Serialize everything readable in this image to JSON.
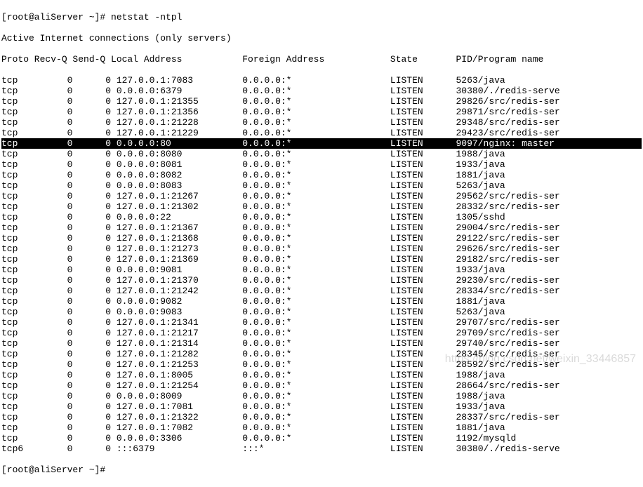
{
  "terminal": {
    "line0": "[root@aliServer ~]# netstat -ntpl",
    "line1": "Active Internet connections (only servers)",
    "header": {
      "proto": "Proto",
      "recvq": "Recv-Q",
      "sendq": "Send-Q",
      "local": "Local Address",
      "foreign": "Foreign Address",
      "state": "State",
      "pid": "PID/Program name"
    },
    "rows": [
      {
        "proto": "tcp",
        "recvq": "0",
        "sendq": "0",
        "local": "127.0.0.1:7083",
        "foreign": "0.0.0.0:*",
        "state": "LISTEN",
        "pid": "5263/java",
        "hl": false
      },
      {
        "proto": "tcp",
        "recvq": "0",
        "sendq": "0",
        "local": "0.0.0.0:6379",
        "foreign": "0.0.0.0:*",
        "state": "LISTEN",
        "pid": "30380/./redis-serve",
        "hl": false
      },
      {
        "proto": "tcp",
        "recvq": "0",
        "sendq": "0",
        "local": "127.0.0.1:21355",
        "foreign": "0.0.0.0:*",
        "state": "LISTEN",
        "pid": "29826/src/redis-ser",
        "hl": false
      },
      {
        "proto": "tcp",
        "recvq": "0",
        "sendq": "0",
        "local": "127.0.0.1:21356",
        "foreign": "0.0.0.0:*",
        "state": "LISTEN",
        "pid": "29871/src/redis-ser",
        "hl": false
      },
      {
        "proto": "tcp",
        "recvq": "0",
        "sendq": "0",
        "local": "127.0.0.1:21228",
        "foreign": "0.0.0.0:*",
        "state": "LISTEN",
        "pid": "29348/src/redis-ser",
        "hl": false
      },
      {
        "proto": "tcp",
        "recvq": "0",
        "sendq": "0",
        "local": "127.0.0.1:21229",
        "foreign": "0.0.0.0:*",
        "state": "LISTEN",
        "pid": "29423/src/redis-ser",
        "hl": false
      },
      {
        "proto": "tcp",
        "recvq": "0",
        "sendq": "0",
        "local": "0.0.0.0:80",
        "foreign": "0.0.0.0:*",
        "state": "LISTEN",
        "pid": "9097/nginx: master",
        "hl": true
      },
      {
        "proto": "tcp",
        "recvq": "0",
        "sendq": "0",
        "local": "0.0.0.0:8080",
        "foreign": "0.0.0.0:*",
        "state": "LISTEN",
        "pid": "1988/java",
        "hl": false
      },
      {
        "proto": "tcp",
        "recvq": "0",
        "sendq": "0",
        "local": "0.0.0.0:8081",
        "foreign": "0.0.0.0:*",
        "state": "LISTEN",
        "pid": "1933/java",
        "hl": false
      },
      {
        "proto": "tcp",
        "recvq": "0",
        "sendq": "0",
        "local": "0.0.0.0:8082",
        "foreign": "0.0.0.0:*",
        "state": "LISTEN",
        "pid": "1881/java",
        "hl": false
      },
      {
        "proto": "tcp",
        "recvq": "0",
        "sendq": "0",
        "local": "0.0.0.0:8083",
        "foreign": "0.0.0.0:*",
        "state": "LISTEN",
        "pid": "5263/java",
        "hl": false
      },
      {
        "proto": "tcp",
        "recvq": "0",
        "sendq": "0",
        "local": "127.0.0.1:21267",
        "foreign": "0.0.0.0:*",
        "state": "LISTEN",
        "pid": "29562/src/redis-ser",
        "hl": false
      },
      {
        "proto": "tcp",
        "recvq": "0",
        "sendq": "0",
        "local": "127.0.0.1:21302",
        "foreign": "0.0.0.0:*",
        "state": "LISTEN",
        "pid": "28332/src/redis-ser",
        "hl": false
      },
      {
        "proto": "tcp",
        "recvq": "0",
        "sendq": "0",
        "local": "0.0.0.0:22",
        "foreign": "0.0.0.0:*",
        "state": "LISTEN",
        "pid": "1305/sshd",
        "hl": false
      },
      {
        "proto": "tcp",
        "recvq": "0",
        "sendq": "0",
        "local": "127.0.0.1:21367",
        "foreign": "0.0.0.0:*",
        "state": "LISTEN",
        "pid": "29004/src/redis-ser",
        "hl": false
      },
      {
        "proto": "tcp",
        "recvq": "0",
        "sendq": "0",
        "local": "127.0.0.1:21368",
        "foreign": "0.0.0.0:*",
        "state": "LISTEN",
        "pid": "29122/src/redis-ser",
        "hl": false
      },
      {
        "proto": "tcp",
        "recvq": "0",
        "sendq": "0",
        "local": "127.0.0.1:21273",
        "foreign": "0.0.0.0:*",
        "state": "LISTEN",
        "pid": "29626/src/redis-ser",
        "hl": false
      },
      {
        "proto": "tcp",
        "recvq": "0",
        "sendq": "0",
        "local": "127.0.0.1:21369",
        "foreign": "0.0.0.0:*",
        "state": "LISTEN",
        "pid": "29182/src/redis-ser",
        "hl": false
      },
      {
        "proto": "tcp",
        "recvq": "0",
        "sendq": "0",
        "local": "0.0.0.0:9081",
        "foreign": "0.0.0.0:*",
        "state": "LISTEN",
        "pid": "1933/java",
        "hl": false
      },
      {
        "proto": "tcp",
        "recvq": "0",
        "sendq": "0",
        "local": "127.0.0.1:21370",
        "foreign": "0.0.0.0:*",
        "state": "LISTEN",
        "pid": "29230/src/redis-ser",
        "hl": false
      },
      {
        "proto": "tcp",
        "recvq": "0",
        "sendq": "0",
        "local": "127.0.0.1:21242",
        "foreign": "0.0.0.0:*",
        "state": "LISTEN",
        "pid": "28334/src/redis-ser",
        "hl": false
      },
      {
        "proto": "tcp",
        "recvq": "0",
        "sendq": "0",
        "local": "0.0.0.0:9082",
        "foreign": "0.0.0.0:*",
        "state": "LISTEN",
        "pid": "1881/java",
        "hl": false
      },
      {
        "proto": "tcp",
        "recvq": "0",
        "sendq": "0",
        "local": "0.0.0.0:9083",
        "foreign": "0.0.0.0:*",
        "state": "LISTEN",
        "pid": "5263/java",
        "hl": false
      },
      {
        "proto": "tcp",
        "recvq": "0",
        "sendq": "0",
        "local": "127.0.0.1:21341",
        "foreign": "0.0.0.0:*",
        "state": "LISTEN",
        "pid": "29707/src/redis-ser",
        "hl": false
      },
      {
        "proto": "tcp",
        "recvq": "0",
        "sendq": "0",
        "local": "127.0.0.1:21217",
        "foreign": "0.0.0.0:*",
        "state": "LISTEN",
        "pid": "29709/src/redis-ser",
        "hl": false
      },
      {
        "proto": "tcp",
        "recvq": "0",
        "sendq": "0",
        "local": "127.0.0.1:21314",
        "foreign": "0.0.0.0:*",
        "state": "LISTEN",
        "pid": "29740/src/redis-ser",
        "hl": false
      },
      {
        "proto": "tcp",
        "recvq": "0",
        "sendq": "0",
        "local": "127.0.0.1:21282",
        "foreign": "0.0.0.0:*",
        "state": "LISTEN",
        "pid": "28345/src/redis-ser",
        "hl": false
      },
      {
        "proto": "tcp",
        "recvq": "0",
        "sendq": "0",
        "local": "127.0.0.1:21253",
        "foreign": "0.0.0.0:*",
        "state": "LISTEN",
        "pid": "28592/src/redis-ser",
        "hl": false
      },
      {
        "proto": "tcp",
        "recvq": "0",
        "sendq": "0",
        "local": "127.0.0.1:8005",
        "foreign": "0.0.0.0:*",
        "state": "LISTEN",
        "pid": "1988/java",
        "hl": false
      },
      {
        "proto": "tcp",
        "recvq": "0",
        "sendq": "0",
        "local": "127.0.0.1:21254",
        "foreign": "0.0.0.0:*",
        "state": "LISTEN",
        "pid": "28664/src/redis-ser",
        "hl": false
      },
      {
        "proto": "tcp",
        "recvq": "0",
        "sendq": "0",
        "local": "0.0.0.0:8009",
        "foreign": "0.0.0.0:*",
        "state": "LISTEN",
        "pid": "1988/java",
        "hl": false
      },
      {
        "proto": "tcp",
        "recvq": "0",
        "sendq": "0",
        "local": "127.0.0.1:7081",
        "foreign": "0.0.0.0:*",
        "state": "LISTEN",
        "pid": "1933/java",
        "hl": false
      },
      {
        "proto": "tcp",
        "recvq": "0",
        "sendq": "0",
        "local": "127.0.0.1:21322",
        "foreign": "0.0.0.0:*",
        "state": "LISTEN",
        "pid": "28337/src/redis-ser",
        "hl": false
      },
      {
        "proto": "tcp",
        "recvq": "0",
        "sendq": "0",
        "local": "127.0.0.1:7082",
        "foreign": "0.0.0.0:*",
        "state": "LISTEN",
        "pid": "1881/java",
        "hl": false
      },
      {
        "proto": "tcp",
        "recvq": "0",
        "sendq": "0",
        "local": "0.0.0.0:3306",
        "foreign": "0.0.0.0:*",
        "state": "LISTEN",
        "pid": "1192/mysqld",
        "hl": false
      },
      {
        "proto": "tcp6",
        "recvq": "0",
        "sendq": "0",
        "local": ":::6379",
        "foreign": ":::*",
        "state": "LISTEN",
        "pid": "30380/./redis-serve",
        "hl": false
      }
    ],
    "prompt_end": "[root@aliServer ~]#",
    "watermark": "https://blog.csdn.net/weixin_33446857"
  }
}
